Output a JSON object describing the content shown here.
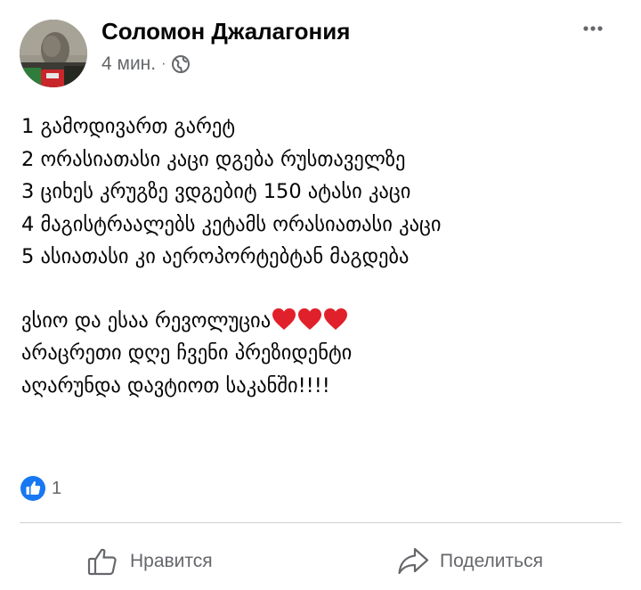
{
  "post": {
    "author": "Соломон Джалагония",
    "time": "4 мин.",
    "separator": "·",
    "privacy_icon": "globe-icon",
    "menu_icon": "more-options-icon",
    "text_lines": [
      "1 გამოდივართ გარეტ",
      "2 ორასიათასი კაცი დგება რუსთაველზე",
      "3 ციხეს კრუგზე ვდგებიტ 150 ატასი კაცი",
      "4 მაგისტრაალებს კეტამს ორასიათასი კაცი",
      "5 ასიათასი კი აეროპორტებტან მაგდება"
    ],
    "text_lines_2": [
      "ვსიო და ესაა რევოლუცია",
      "არაცრეთი დღე ჩვენი პრეზიდენტი",
      "აღარუნდა დავტიოთ საკანში!!!!"
    ],
    "emoji": [
      "red-heart",
      "red-heart",
      "red-heart"
    ],
    "accent_color": "#1877f2",
    "heart_color": "#e0202a"
  },
  "reactions": {
    "icon": "like-reaction-icon",
    "count": "1"
  },
  "actions": {
    "like_label": "Нравится",
    "share_label": "Поделиться"
  }
}
